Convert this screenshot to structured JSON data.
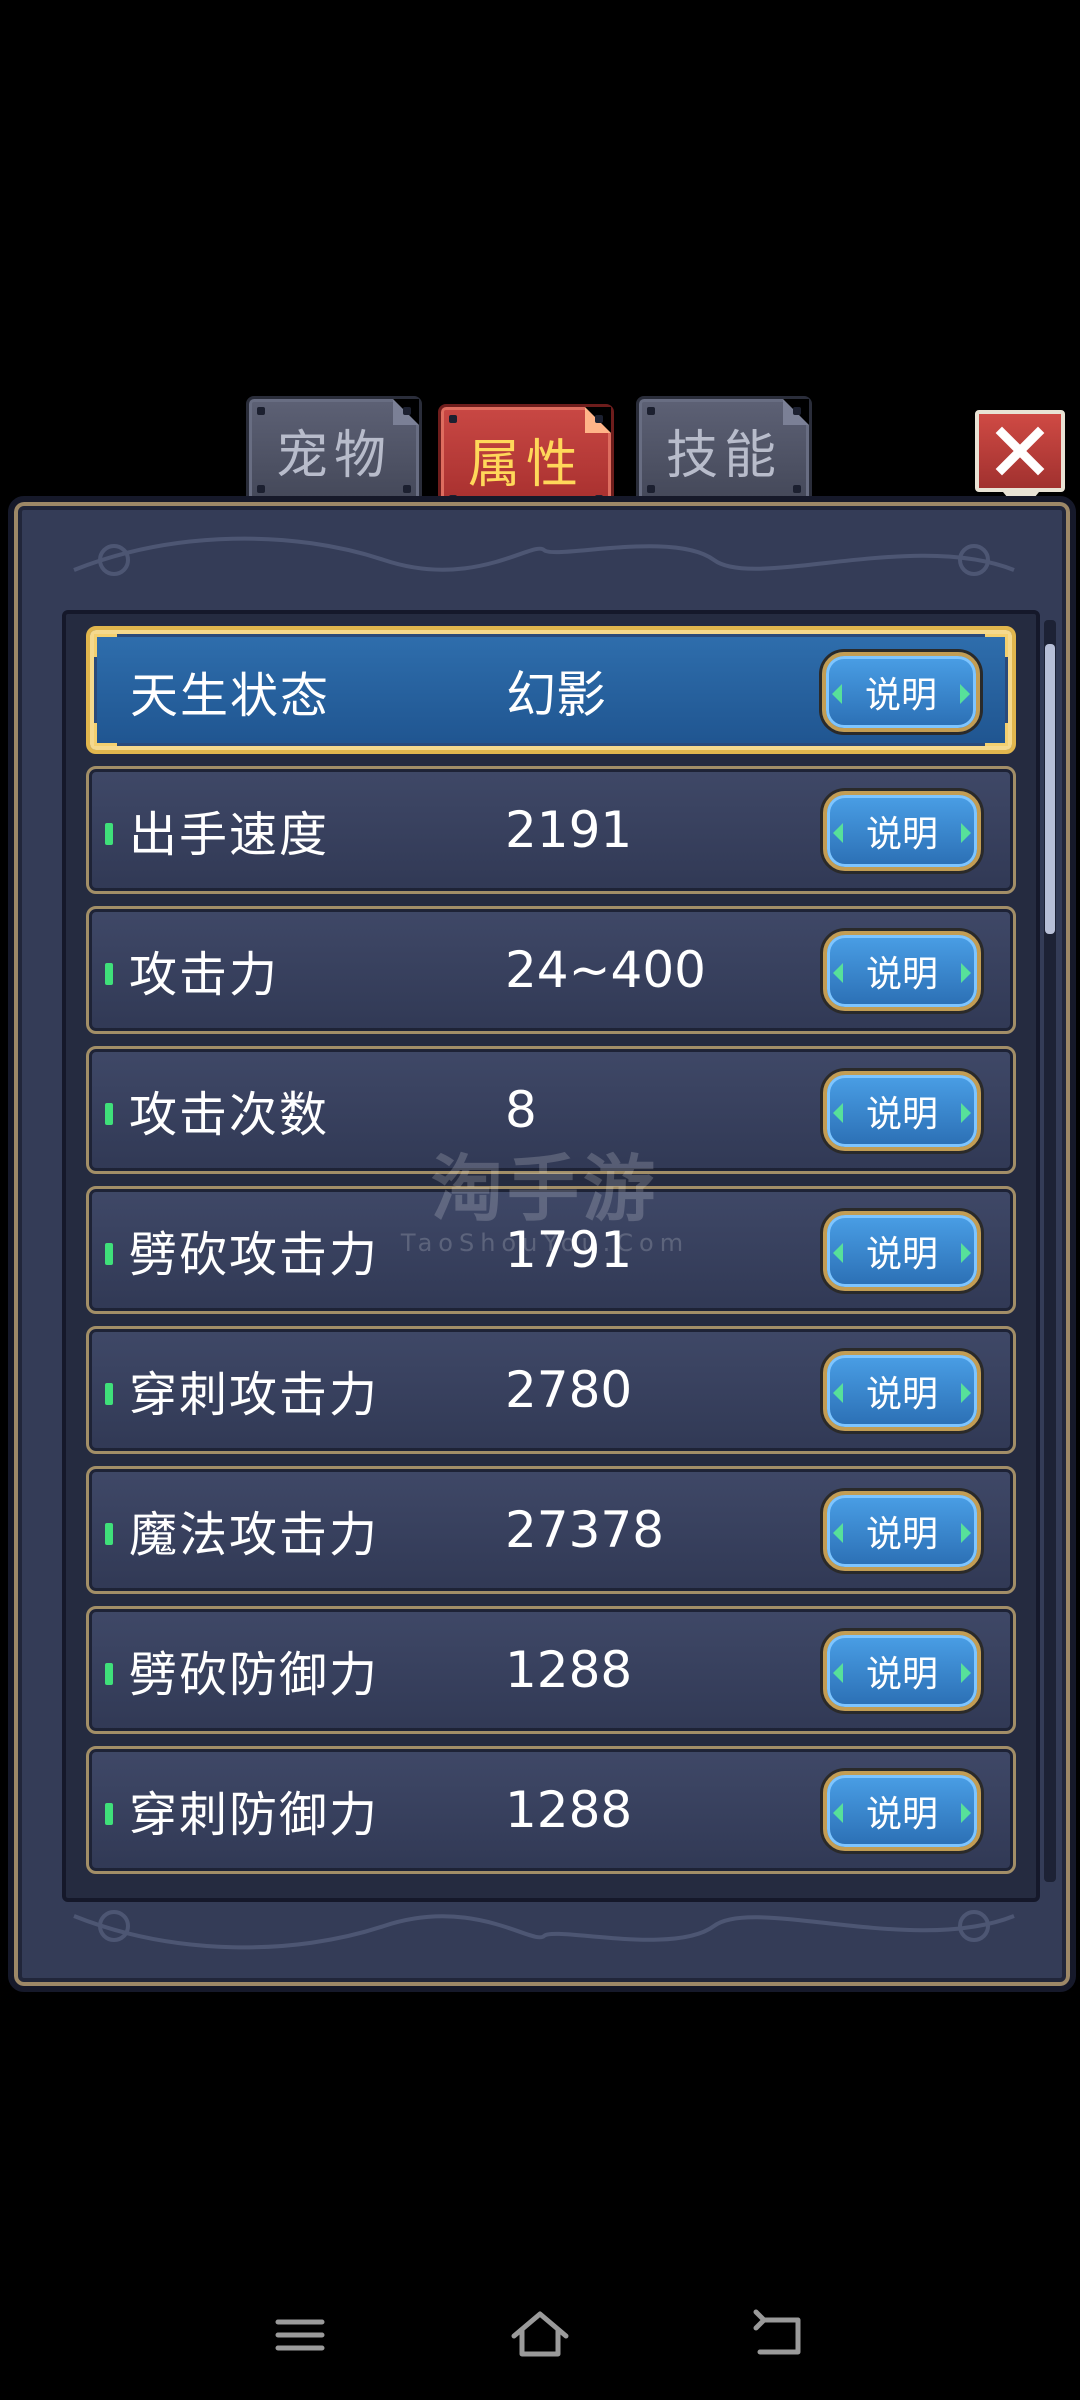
{
  "tabs": [
    {
      "label": "宠物",
      "active": false
    },
    {
      "label": "属性",
      "active": true
    },
    {
      "label": "技能",
      "active": false
    }
  ],
  "attributes": [
    {
      "label": "天生状态",
      "value": "幻影",
      "button": "说明",
      "highlight": true
    },
    {
      "label": "出手速度",
      "value": "2191",
      "button": "说明"
    },
    {
      "label": "攻击力",
      "value": "24~400",
      "button": "说明"
    },
    {
      "label": "攻击次数",
      "value": "8",
      "button": "说明"
    },
    {
      "label": "劈砍攻击力",
      "value": "1791",
      "button": "说明"
    },
    {
      "label": "穿刺攻击力",
      "value": "2780",
      "button": "说明"
    },
    {
      "label": "魔法攻击力",
      "value": "27378",
      "button": "说明"
    },
    {
      "label": "劈砍防御力",
      "value": "1288",
      "button": "说明"
    },
    {
      "label": "穿刺防御力",
      "value": "1288",
      "button": "说明"
    }
  ],
  "watermark": {
    "main": "淘手游",
    "sub": "TaoShouYou.Com"
  },
  "icons": {
    "close": "close-icon",
    "nav": [
      "menu-icon",
      "home-icon",
      "back-icon"
    ]
  },
  "colors": {
    "panel": "#343c57",
    "highlight_row": "#2f6fae",
    "active_tab": "#c94844",
    "active_tab_text": "#ffd85a",
    "button": "#3b8ad2",
    "indicator": "#3fe07a"
  }
}
